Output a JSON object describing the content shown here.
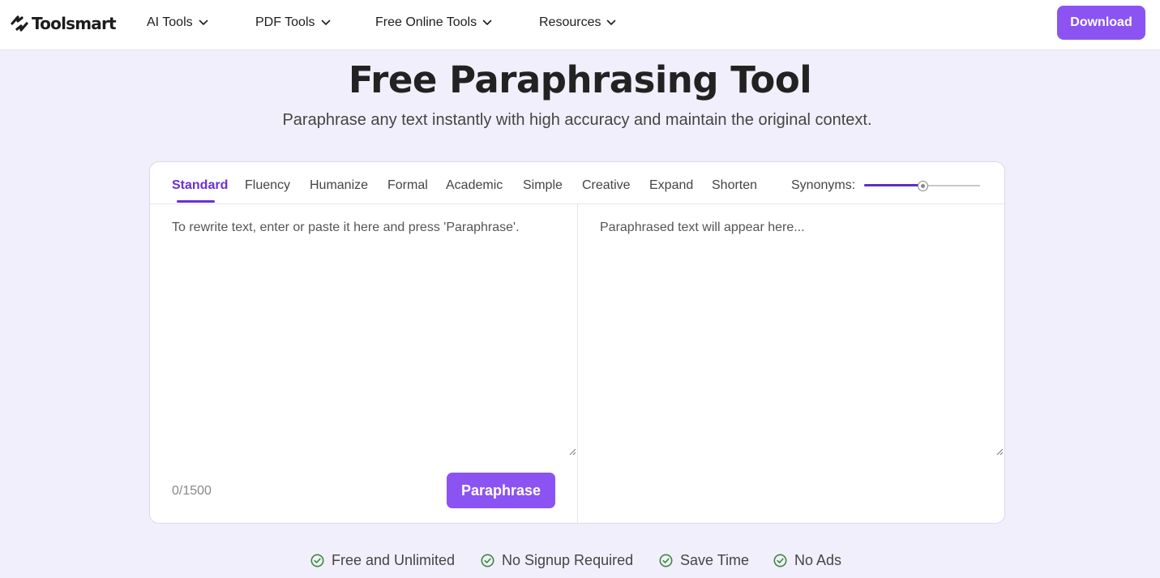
{
  "header": {
    "logo_text": "Toolsmart",
    "nav": [
      {
        "label": "AI Tools",
        "icon": "chevron-down-icon"
      },
      {
        "label": "PDF Tools",
        "icon": "chevron-down-icon"
      },
      {
        "label": "Free Online Tools",
        "icon": "chevron-down-icon"
      },
      {
        "label": "Resources",
        "icon": "chevron-down-icon"
      }
    ],
    "download_label": "Download"
  },
  "hero": {
    "title": "Free Paraphrasing Tool",
    "subtitle": "Paraphrase any text instantly with high accuracy and maintain the original context."
  },
  "tool": {
    "modes": [
      "Standard",
      "Fluency",
      "Humanize",
      "Formal",
      "Academic",
      "Simple",
      "Creative",
      "Expand",
      "Shorten"
    ],
    "active_mode": "Standard",
    "synonyms_label": "Synonyms:",
    "synonyms_level": 0.5,
    "input_placeholder": "To rewrite text, enter or paste it here and press 'Paraphrase'.",
    "output_placeholder": "Paraphrased text will appear here...",
    "counter": "0/1500",
    "paraphrase_label": "Paraphrase"
  },
  "features": [
    {
      "label": "Free and Unlimited",
      "icon": "check-circle-icon"
    },
    {
      "label": "No Signup Required",
      "icon": "check-circle-icon"
    },
    {
      "label": "Save Time",
      "icon": "check-circle-icon"
    },
    {
      "label": "No Ads",
      "icon": "check-circle-icon"
    }
  ],
  "colors": {
    "brand": "#8b53f2",
    "active_tab": "#6b2fd6",
    "page_bg": "#f2effc",
    "check_green": "#3a8a3a"
  }
}
